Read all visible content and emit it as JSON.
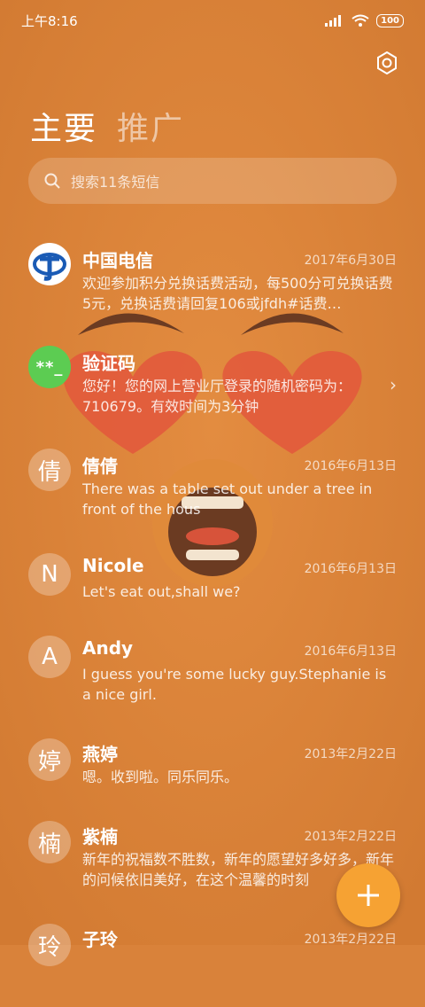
{
  "status_bar": {
    "time": "上午8:16",
    "battery": "100"
  },
  "tabs": [
    {
      "label": "主要"
    },
    {
      "label": "推广"
    }
  ],
  "search": {
    "placeholder": "搜索11条短信"
  },
  "conversations": [
    {
      "name": "中国电信",
      "date": "2017年6月30日",
      "snippet": "欢迎参加积分兑换话费活动，每500分可兑换话费5元，兑换话费请回复106或jfdh#话费…",
      "avatar_icon": "china-telecom-logo"
    },
    {
      "name": "验证码",
      "date": "",
      "snippet": "您好！您的网上营业厅登录的随机密码为：710679。有效时间为3分钟",
      "avatar_text": "**_"
    },
    {
      "name": "倩倩",
      "date": "2016年6月13日",
      "snippet": "There was a table set out under a tree in front of the hous",
      "avatar_text": "倩"
    },
    {
      "name": "Nicole",
      "date": "2016年6月13日",
      "snippet": "Let's eat out,shall we?",
      "avatar_text": "N"
    },
    {
      "name": "Andy",
      "date": "2016年6月13日",
      "snippet": "I guess you're some lucky guy.Stephanie is a nice girl.",
      "avatar_text": "A"
    },
    {
      "name": "燕婷",
      "date": "2013年2月22日",
      "snippet": "嗯。收到啦。同乐同乐。",
      "avatar_text": "婷"
    },
    {
      "name": "紫楠",
      "date": "2013年2月22日",
      "snippet": "新年的祝福数不胜数，新年的愿望好多好多，新年的问候依旧美好，在这个温馨的时刻",
      "avatar_text": "楠"
    },
    {
      "name": "子玲",
      "date": "2013年2月22日",
      "snippet": "",
      "avatar_text": "玲"
    }
  ],
  "colors": {
    "background": "#d9823a",
    "fab": "#f6a233",
    "code_avatar": "#5ccc52",
    "telecom_blue": "#1a5bb5"
  }
}
